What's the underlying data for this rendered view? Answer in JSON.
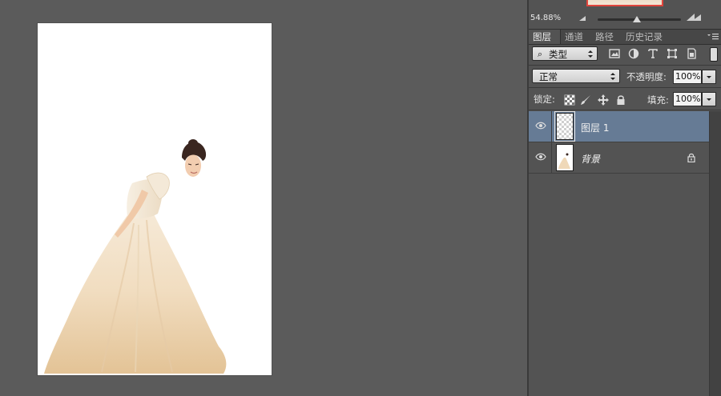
{
  "navigator": {
    "zoom": "54.88%"
  },
  "panel_tabs": [
    {
      "label": "图层",
      "active": true
    },
    {
      "label": "通道",
      "active": false
    },
    {
      "label": "路径",
      "active": false
    },
    {
      "label": "历史记录",
      "active": false
    }
  ],
  "filter": {
    "kind_label": "类型",
    "icons": [
      "image-filter-icon",
      "adjustment-filter-icon",
      "type-filter-icon",
      "shape-filter-icon",
      "smart-object-filter-icon"
    ]
  },
  "blend": {
    "mode": "正常",
    "opacity_label": "不透明度:",
    "opacity_value": "100%"
  },
  "lock": {
    "label": "锁定:",
    "fill_label": "填充:",
    "fill_value": "100%"
  },
  "layers": [
    {
      "name": "图层 1",
      "selected": true,
      "visible": true,
      "locked": false
    },
    {
      "name": "背景",
      "selected": false,
      "visible": true,
      "locked": true
    }
  ],
  "colors": {
    "workspace": "#5b5b5b",
    "panel": "#535353",
    "selected_layer": "#667b95",
    "navigator_frame": "#e0453d"
  }
}
